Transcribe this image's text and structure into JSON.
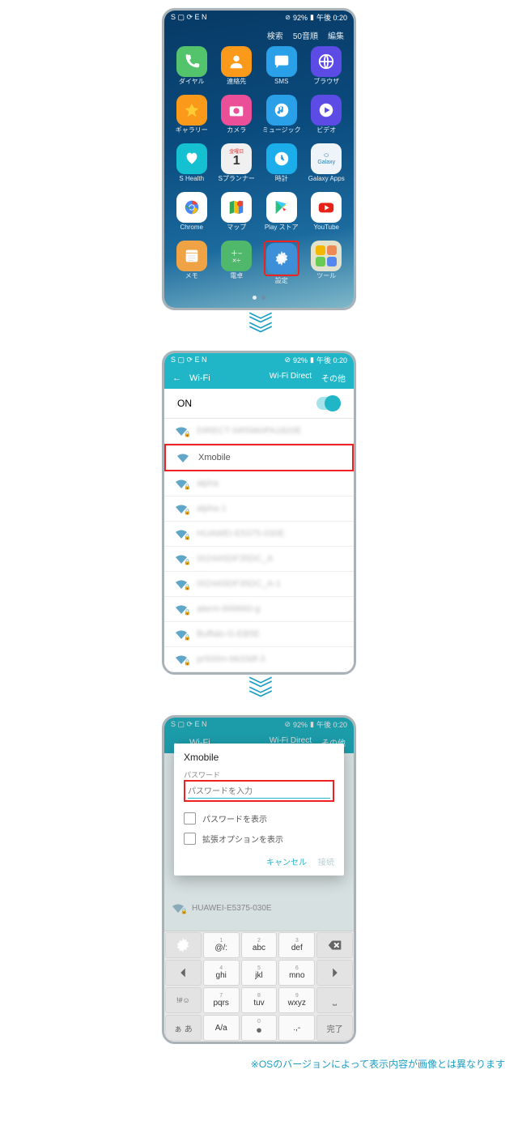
{
  "status": {
    "left": "S ▢ ⟳ E N",
    "battery": "92%",
    "time": "午後 0:20"
  },
  "screen1": {
    "menu": [
      "検索",
      "50音順",
      "編集"
    ],
    "apps": [
      {
        "label": "ダイヤル",
        "icon": "phone",
        "cls": "bg-green"
      },
      {
        "label": "連絡先",
        "icon": "contact",
        "cls": "bg-orange"
      },
      {
        "label": "SMS",
        "icon": "sms",
        "cls": "bg-blue"
      },
      {
        "label": "ブラウザ",
        "icon": "globe",
        "cls": "bg-violet"
      },
      {
        "label": "ギャラリー",
        "icon": "flower",
        "cls": "bg-orange"
      },
      {
        "label": "カメラ",
        "icon": "camera",
        "cls": "bg-pink"
      },
      {
        "label": "ミュージック",
        "icon": "music",
        "cls": "bg-blue"
      },
      {
        "label": "ビデオ",
        "icon": "video",
        "cls": "bg-violet"
      },
      {
        "label": "S Health",
        "icon": "health",
        "cls": "bg-teal"
      },
      {
        "label": "Sプランナー",
        "icon": "calendar",
        "cls": "bg-white",
        "text": "金曜日\n1"
      },
      {
        "label": "時計",
        "icon": "clock",
        "cls": "bg-cyan"
      },
      {
        "label": "Galaxy Apps",
        "icon": "galaxy",
        "cls": "bg-galaxy"
      },
      {
        "label": "Chrome",
        "icon": "chrome",
        "cls": "bg-chrome"
      },
      {
        "label": "マップ",
        "icon": "maps",
        "cls": "bg-maps"
      },
      {
        "label": "Play ストア",
        "icon": "play",
        "cls": "bg-play"
      },
      {
        "label": "YouTube",
        "icon": "youtube",
        "cls": "bg-youtube"
      },
      {
        "label": "メモ",
        "icon": "memo",
        "cls": "bg-memo"
      },
      {
        "label": "電卓",
        "icon": "calc",
        "cls": "bg-calc"
      },
      {
        "label": "設定",
        "icon": "gear",
        "cls": "bg-gear",
        "highlight": true
      },
      {
        "label": "ツール",
        "icon": "tools",
        "cls": "bg-tools"
      }
    ]
  },
  "screen2": {
    "back_icon": "←",
    "title": "Wi-Fi",
    "actions": [
      "Wi-Fi Direct",
      "その他"
    ],
    "toggle_label": "ON",
    "networks": [
      {
        "ssid": "DIRECT-SR5960PA1820E",
        "lock": true,
        "blur": true
      },
      {
        "ssid": "Xmobile",
        "lock": false,
        "blur": false,
        "highlight": true
      },
      {
        "ssid": "alpha",
        "lock": true,
        "blur": true
      },
      {
        "ssid": "alpha-1",
        "lock": true,
        "blur": true
      },
      {
        "ssid": "HUAWEI-E5375-030E",
        "lock": true,
        "blur": true
      },
      {
        "ssid": "0024A5DF35DC_A",
        "lock": true,
        "blur": true
      },
      {
        "ssid": "0024A5DF35DC_A-1",
        "lock": true,
        "blur": true
      },
      {
        "ssid": "aterm-699660-g",
        "lock": true,
        "blur": true
      },
      {
        "ssid": "Buffalo-G-EB5E",
        "lock": true,
        "blur": true
      },
      {
        "ssid": "pr500m-bb33df-3",
        "lock": true,
        "blur": true
      }
    ]
  },
  "screen3": {
    "title": "Wi-Fi",
    "actions": [
      "Wi-Fi Direct",
      "その他"
    ],
    "dialog": {
      "ssid": "Xmobile",
      "pwd_label": "パスワード",
      "pwd_placeholder": "パスワードを入力",
      "show_pwd": "パスワードを表示",
      "show_adv": "拡張オプションを表示",
      "cancel": "キャンセル",
      "connect": "接続"
    },
    "bg_ssid": "HUAWEI-E5375-030E",
    "keyboard": [
      [
        {
          "t": "",
          "sub": "",
          "cls": "gray",
          "icon": "gear"
        },
        {
          "t": "@/:",
          "sub": "1"
        },
        {
          "t": "abc",
          "sub": "2"
        },
        {
          "t": "def",
          "sub": "3"
        },
        {
          "t": "",
          "cls": "gray",
          "icon": "bksp"
        }
      ],
      [
        {
          "t": "",
          "cls": "gray",
          "icon": "left"
        },
        {
          "t": "ghi",
          "sub": "4"
        },
        {
          "t": "jkl",
          "sub": "5"
        },
        {
          "t": "mno",
          "sub": "6"
        },
        {
          "t": "",
          "cls": "gray",
          "icon": "right"
        }
      ],
      [
        {
          "t": "",
          "cls": "gray",
          "icon": "sym"
        },
        {
          "t": "pqrs",
          "sub": "7"
        },
        {
          "t": "tuv",
          "sub": "8"
        },
        {
          "t": "wxyz",
          "sub": "9"
        },
        {
          "t": "",
          "cls": "gray",
          "icon": "sp"
        }
      ],
      [
        {
          "t": "ぁ あ",
          "cls": "gray"
        },
        {
          "t": "A/a",
          "sub": ""
        },
        {
          "t": "",
          "sub": "0",
          "icon": "rec"
        },
        {
          "t": ".,-",
          "sub": ""
        },
        {
          "t": "完了",
          "cls": "gray"
        }
      ]
    ]
  },
  "footnote": "※OSのバージョンによって表示内容が画像とは異なります"
}
